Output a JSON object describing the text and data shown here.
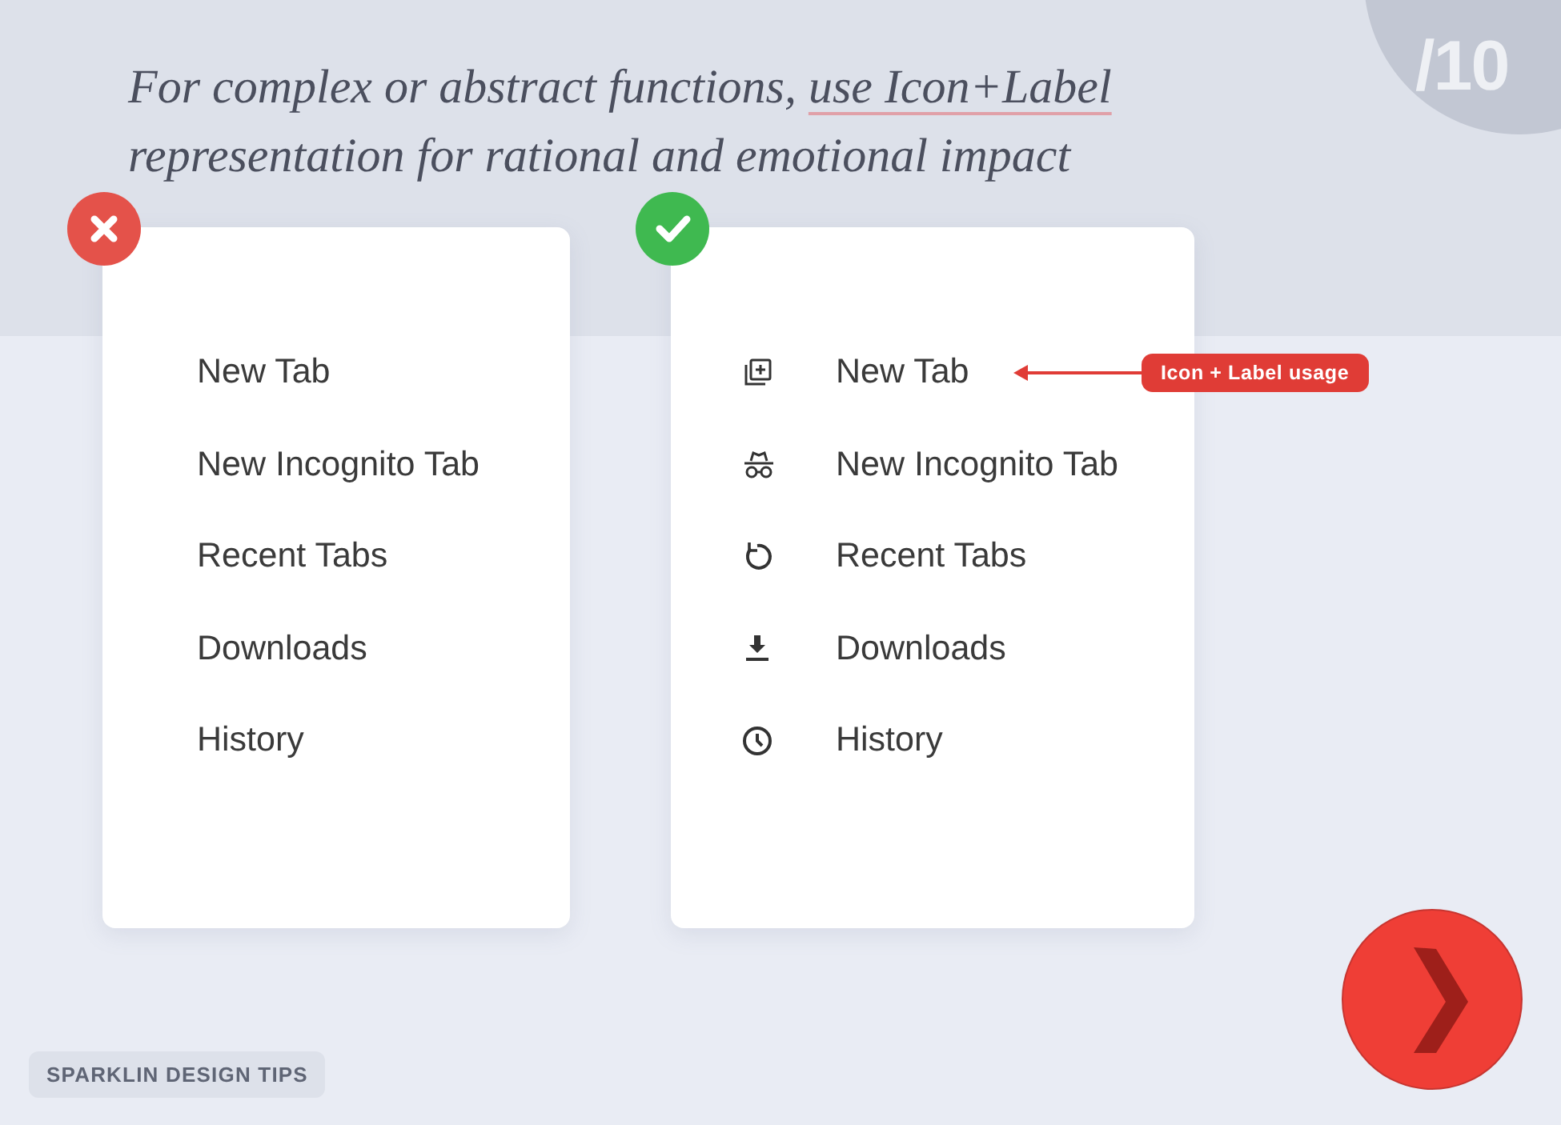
{
  "slide_number": "/10",
  "headline": {
    "lead": "For complex or abstract functions,",
    "highlight": "use Icon+Label",
    "line_2": "representation for rational and emotional impact"
  },
  "panels": [
    {
      "correct": false,
      "show_icons": false,
      "items": [
        {
          "label": "New Tab"
        },
        {
          "label": "New Incognito Tab"
        },
        {
          "label": "Recent Tabs"
        },
        {
          "label": "Downloads"
        },
        {
          "label": "History"
        }
      ]
    },
    {
      "correct": true,
      "show_icons": true,
      "items": [
        {
          "label": "New Tab",
          "callout": "Icon + Label usage"
        },
        {
          "label": "New Incognito Tab"
        },
        {
          "label": "Recent Tabs"
        },
        {
          "label": "Downloads"
        },
        {
          "label": "History"
        }
      ]
    }
  ],
  "footer": {
    "tag": "SPARKLIN DESIGN TIPS"
  }
}
